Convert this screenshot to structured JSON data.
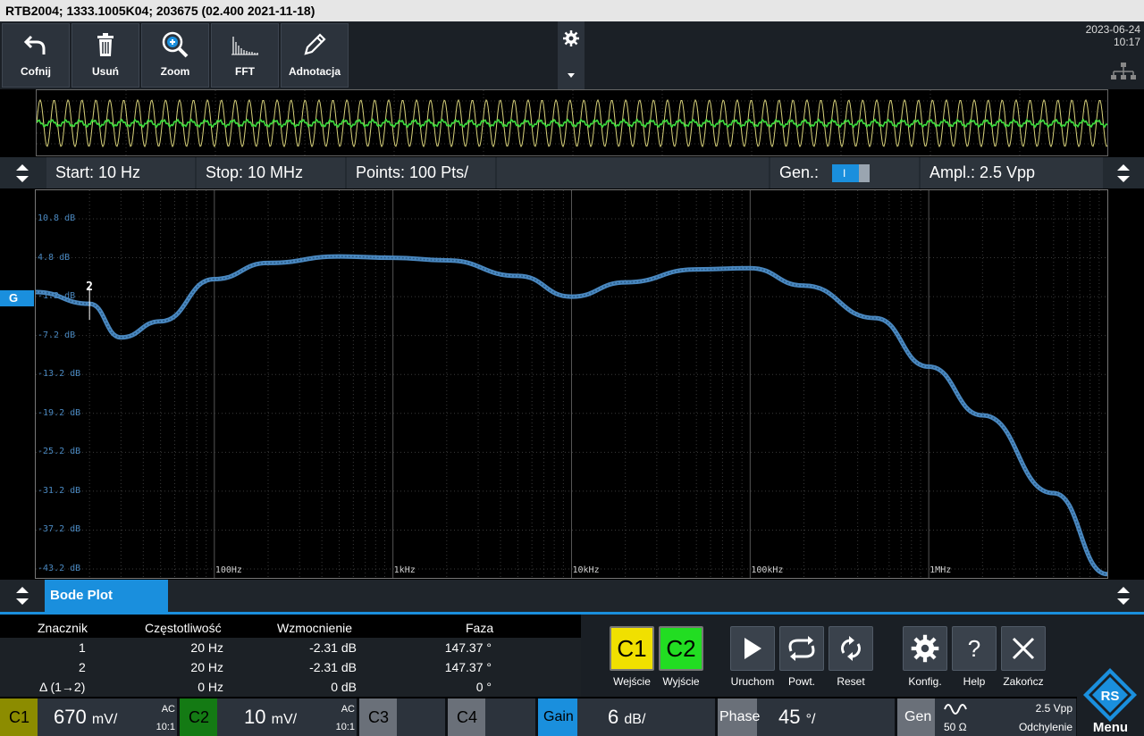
{
  "title": "RTB2004; 1333.1005K04; 203675 (02.400 2021-11-18)",
  "toolbar": {
    "buttons": [
      {
        "label": "Cofnij",
        "icon": "undo-icon"
      },
      {
        "label": "Usuń",
        "icon": "trash-icon"
      },
      {
        "label": "Zoom",
        "icon": "zoom-icon"
      },
      {
        "label": "FFT",
        "icon": "fft-icon"
      },
      {
        "label": "Adnotacja",
        "icon": "pencil-icon"
      }
    ],
    "date": "2023-06-24",
    "time": "10:17"
  },
  "settings": {
    "start": "Start: 10 Hz",
    "stop": "Stop: 10 MHz",
    "points": "Points: 100 Pts/",
    "gen_label": "Gen.:",
    "gen_state": "I",
    "ampl": "Ampl.: 2.5 Vpp"
  },
  "plot": {
    "y_labels": [
      "10.8 dB",
      "4.8 dB",
      "-1.2 dB",
      "-7.2 dB",
      "-13.2 dB",
      "-19.2 dB",
      "-25.2 dB",
      "-31.2 dB",
      "-37.2 dB",
      "-43.2 dB"
    ],
    "x_labels": [
      "100Hz",
      "1kHz",
      "10kHz",
      "100kHz",
      "1MHz"
    ],
    "marker_tag": "G",
    "marker_label": "2",
    "curve_color": "#4a88c0"
  },
  "chart_data": {
    "type": "line",
    "x": [
      10,
      20,
      30,
      50,
      100,
      200,
      500,
      1000,
      2000,
      5000,
      10000,
      20000,
      50000,
      100000,
      200000,
      500000,
      1000000,
      2000000,
      5000000,
      10000000
    ],
    "series": [
      {
        "values": [
          -0.5,
          -2.3,
          -7.5,
          -5.0,
          1.5,
          4.0,
          5.0,
          4.8,
          4.4,
          2.0,
          -1.2,
          1.0,
          3.0,
          3.2,
          0.5,
          -4.5,
          -12.0,
          -19.5,
          -31.5,
          -44.0
        ]
      }
    ],
    "ylim": [
      -43.2,
      10.8
    ],
    "xscale": "log",
    "xlim": [
      10,
      10000000
    ],
    "grid": true
  },
  "tabs": {
    "active": "Bode Plot"
  },
  "results": {
    "headers": [
      "Znacznik",
      "Częstotliwość",
      "Wzmocnienie",
      "Faza"
    ],
    "rows": [
      [
        "1",
        "20 Hz",
        "-2.31 dB",
        "147.37 °"
      ],
      [
        "2",
        "20 Hz",
        "-2.31 dB",
        "147.37 °"
      ],
      [
        "Δ (1→2)",
        "0 Hz",
        "0 dB",
        "0 °"
      ]
    ]
  },
  "controls": {
    "c1": "C1",
    "c2": "C2",
    "wejscie": "Wejście",
    "wyjscie": "Wyjście",
    "uruchom": "Uruchom",
    "powt": "Powt.",
    "reset": "Reset",
    "konfig": "Konfig.",
    "help": "Help",
    "zakoncz": "Zakończ",
    "help_glyph": "?"
  },
  "bottom": {
    "c1": {
      "tag": "C1",
      "value": "670",
      "unit": "mV/",
      "coupling": "AC",
      "ratio": "10:1",
      "color": "#c8c800"
    },
    "c2": {
      "tag": "C2",
      "value": "10",
      "unit": "mV/",
      "coupling": "AC",
      "ratio": "10:1",
      "color": "#1ea01e"
    },
    "c3": {
      "tag": "C3"
    },
    "c4": {
      "tag": "C4"
    },
    "gain": {
      "tag": "Gain",
      "value": "6",
      "unit": "dB/"
    },
    "phase": {
      "tag": "Phase",
      "value": "45",
      "unit": "°/"
    },
    "gen": {
      "tag": "Gen",
      "impedance": "50 Ω",
      "ampl": "2.5 Vpp",
      "offset": "Odchylenie"
    }
  },
  "menu": {
    "label": "Menu",
    "logo": "RS"
  }
}
